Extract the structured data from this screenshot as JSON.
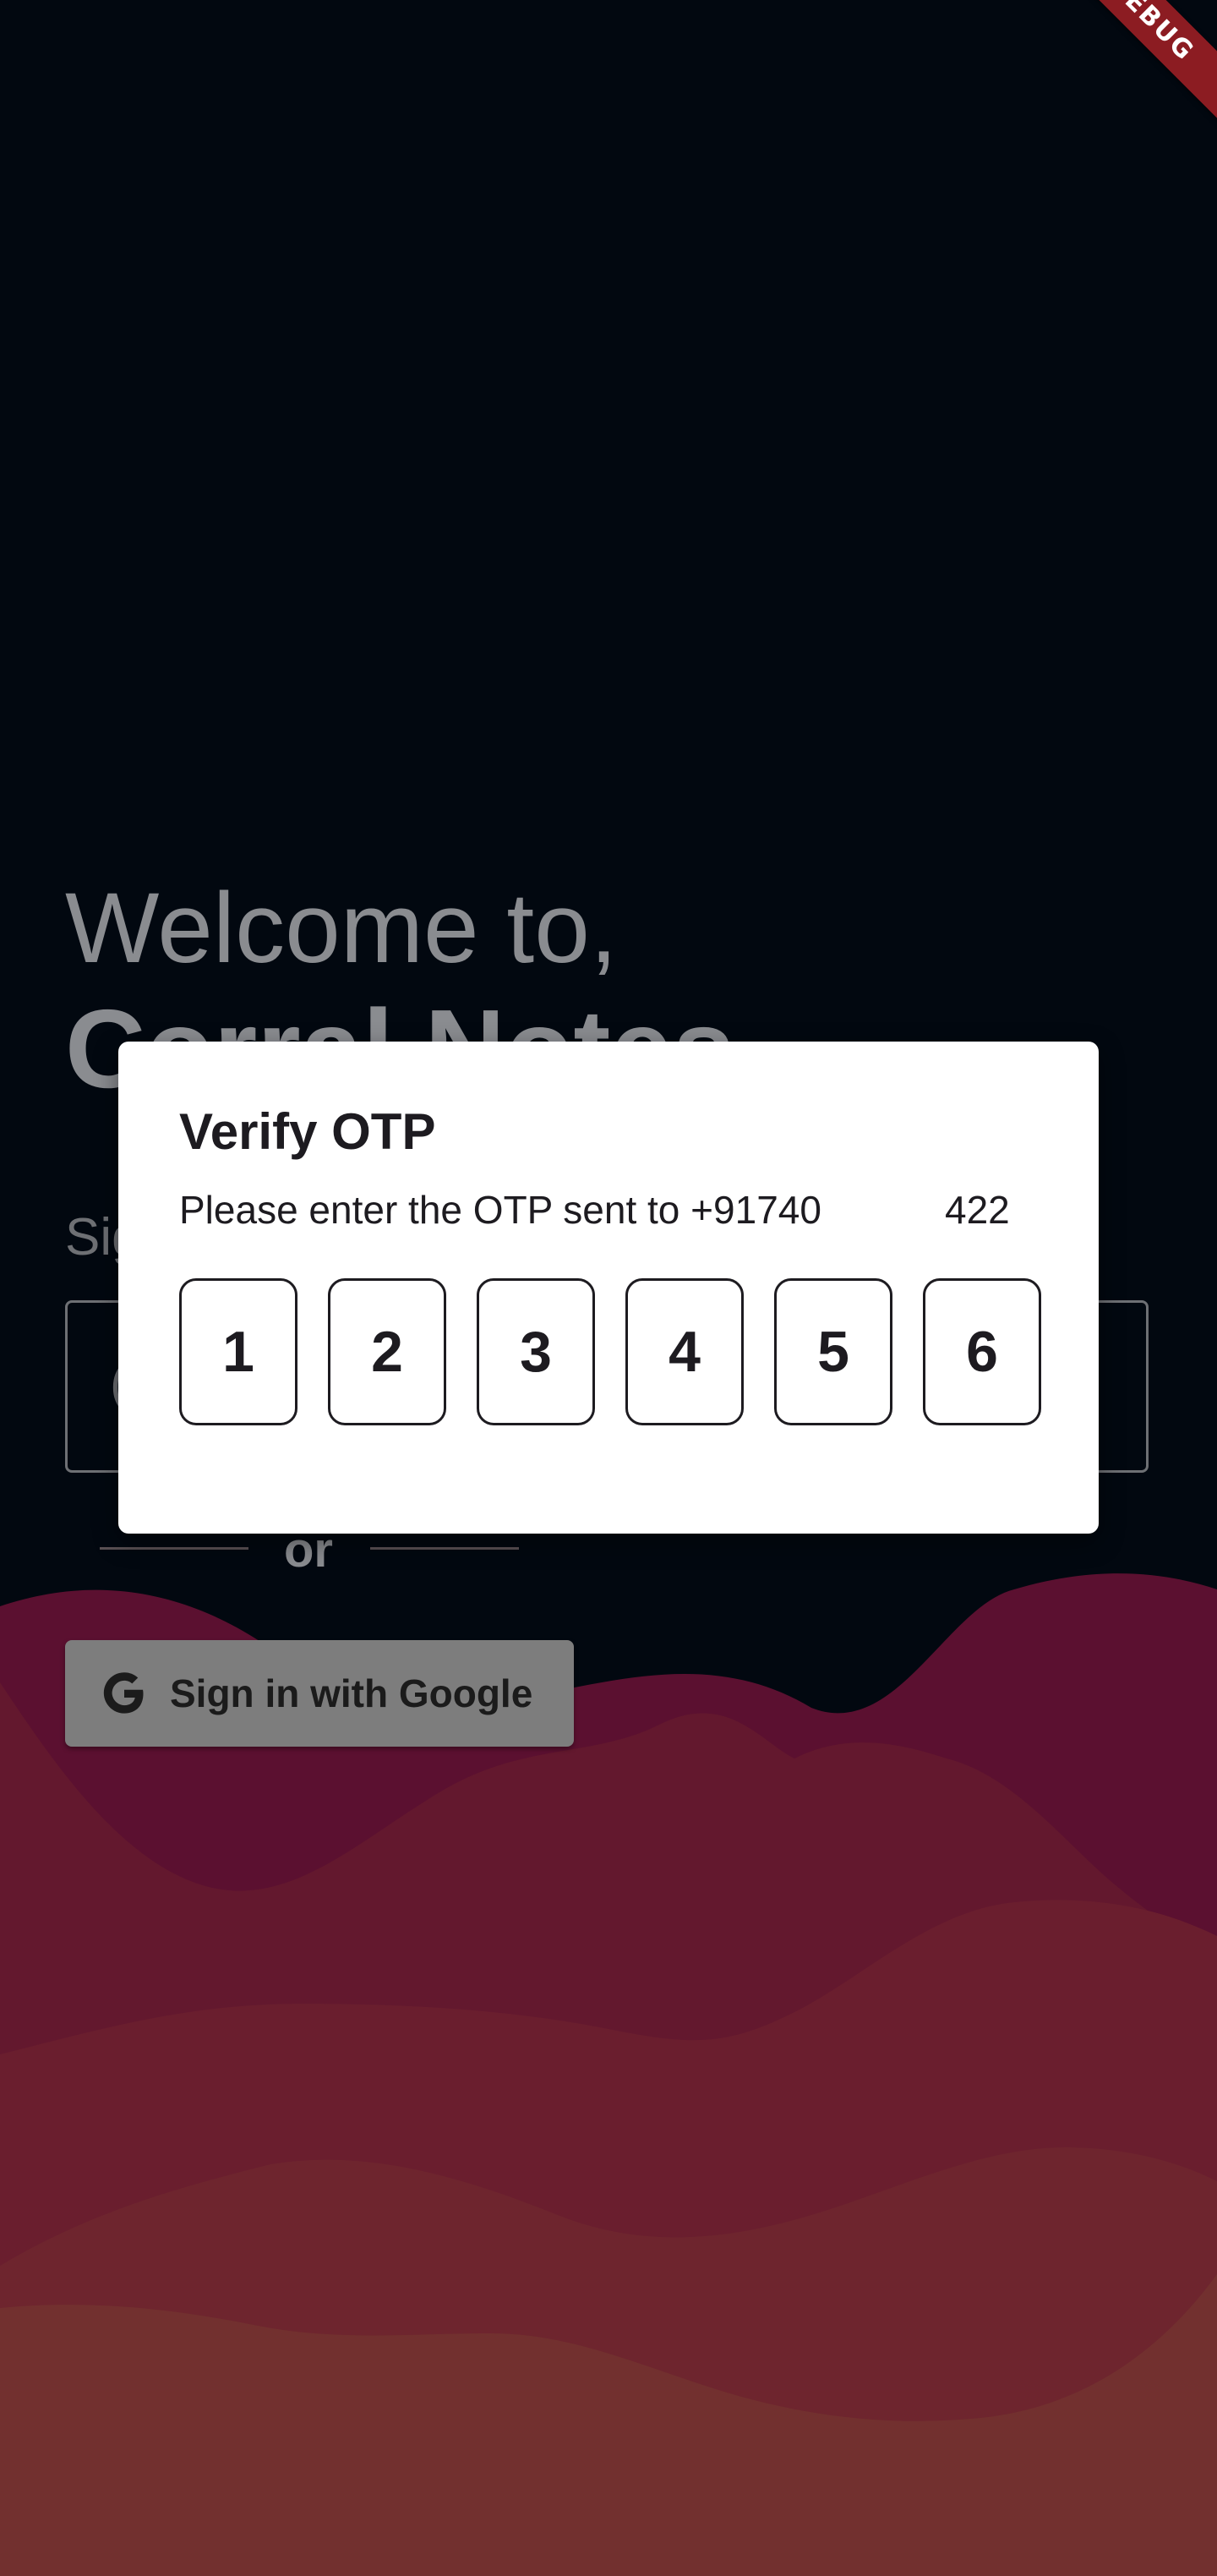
{
  "debug_banner": "DEBUG",
  "welcome": {
    "greeting": "Welcome to,",
    "app_name": "Corral Notes",
    "sign_prefix": "Sig",
    "field_partial": "(",
    "or_label": "or",
    "google_button": "Sign in with Google"
  },
  "dialog": {
    "title": "Verify OTP",
    "message": "Please enter the OTP sent to +91740",
    "message_end": "422",
    "otp_digits": [
      "1",
      "2",
      "3",
      "4",
      "5",
      "6"
    ]
  },
  "colors": {
    "background": "#020810",
    "wave_1": "#5b1030",
    "wave_2": "#63182e",
    "wave_3": "#6a1e2e",
    "wave_4": "#6e252e",
    "wave_5": "#72302f",
    "ribbon": "#8c1c22"
  }
}
